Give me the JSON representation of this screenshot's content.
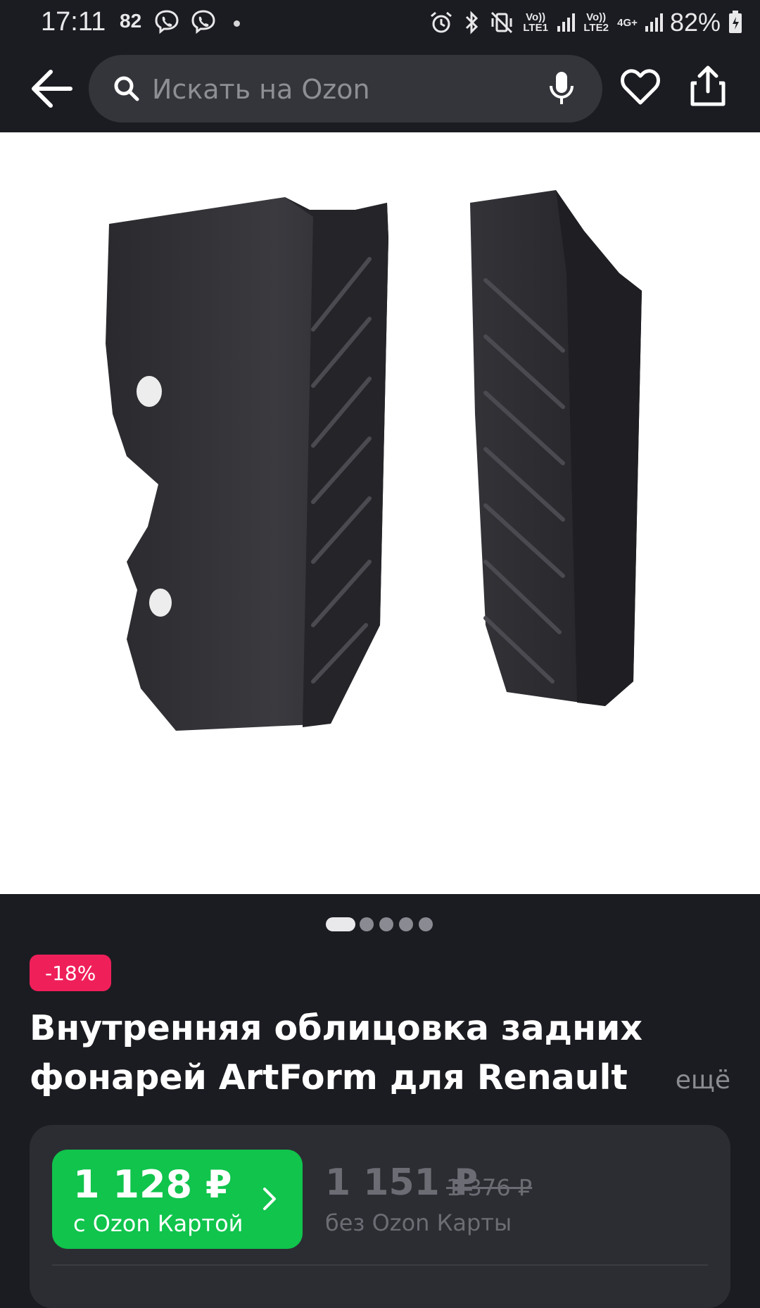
{
  "status_bar": {
    "time": "17:11",
    "notification_count": "82",
    "network1": "Vo)) LTE1",
    "network2": "Vo)) LTE2",
    "network_type": "4G+",
    "battery": "82%"
  },
  "header": {
    "search_placeholder": "Искать на Ozon",
    "icons": [
      "arrow-back-icon",
      "search-icon",
      "mic-icon",
      "heart-icon",
      "share-icon"
    ]
  },
  "gallery": {
    "image_count": 5,
    "active_index": 0
  },
  "product": {
    "discount_badge": "-18%",
    "title": "Внутренняя облицовка задних фонарей ArtForm для Renault",
    "more_label": "ещё"
  },
  "prices": {
    "ozon_card_price": "1 128 ₽",
    "ozon_card_label": "с Ozon Картой",
    "regular_price": "1 151 ₽",
    "old_price": "1 376 ₽",
    "regular_label": "без Ozon Карты"
  },
  "colors": {
    "background": "#1b1c21",
    "card": "#2c2d33",
    "accent_green": "#10c44c",
    "discount_pink": "#ef1f5a"
  }
}
